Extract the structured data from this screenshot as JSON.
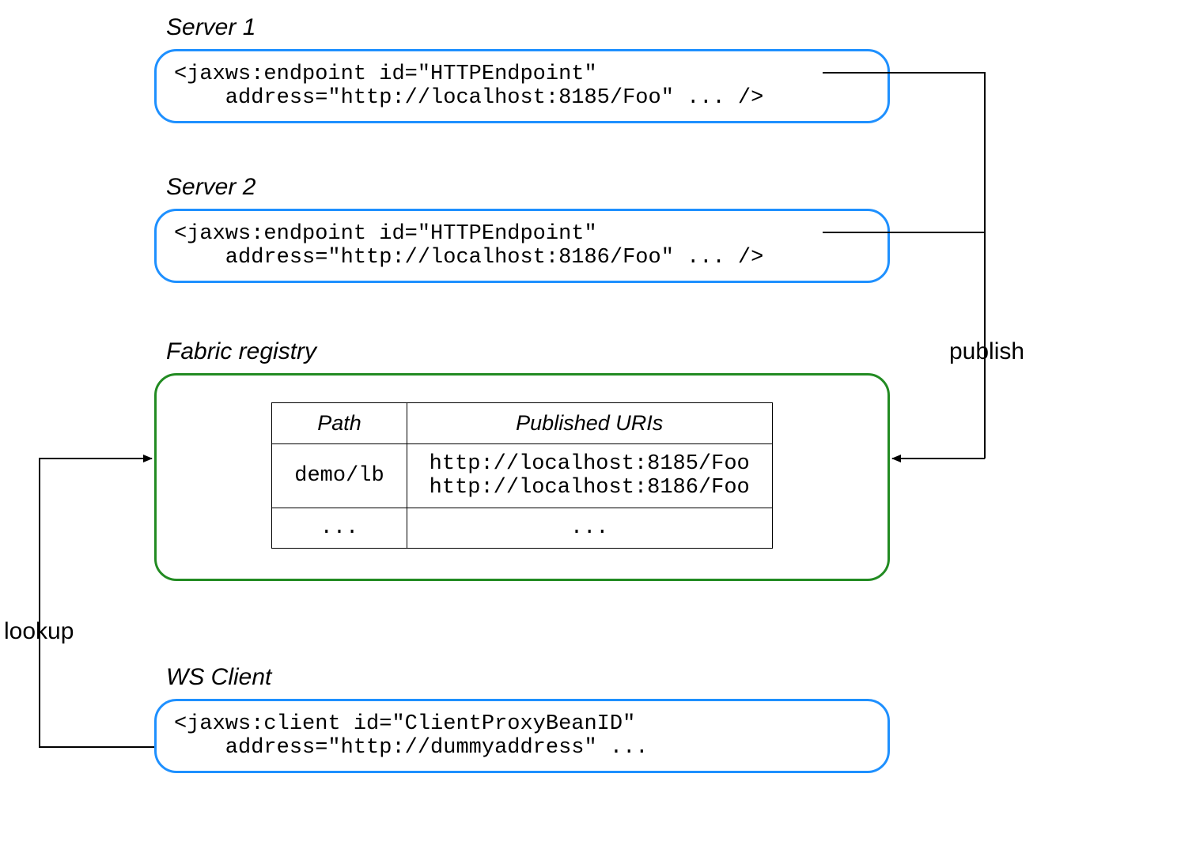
{
  "labels": {
    "server1": "Server 1",
    "server2": "Server 2",
    "registry": "Fabric registry",
    "client": "WS Client",
    "publish": "publish",
    "lookup": "lookup"
  },
  "server1": {
    "code": "<jaxws:endpoint id=\"HTTPEndpoint\"\n    address=\"http://localhost:8185/Foo\" ... />"
  },
  "server2": {
    "code": "<jaxws:endpoint id=\"HTTPEndpoint\"\n    address=\"http://localhost:8186/Foo\" ... />"
  },
  "registry": {
    "headers": {
      "path": "Path",
      "uris": "Published URIs"
    },
    "rows": [
      {
        "path": "demo/lb",
        "uris": "http://localhost:8185/Foo\nhttp://localhost:8186/Foo"
      },
      {
        "path": "...",
        "uris": "..."
      }
    ]
  },
  "client": {
    "code": "<jaxws:client id=\"ClientProxyBeanID\"\n    address=\"http://dummyaddress\" ..."
  }
}
